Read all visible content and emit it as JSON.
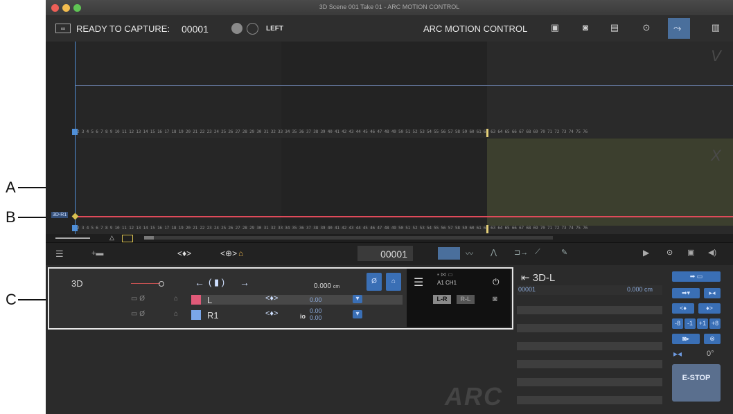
{
  "callouts": {
    "a": "A",
    "b": "B",
    "c": "C"
  },
  "window": {
    "title": "3D Scene 001 Take 01 - ARC MOTION CONTROL"
  },
  "toolbar": {
    "status_label": "READY TO CAPTURE:",
    "take_number": "00001",
    "side_label": "LEFT",
    "app_label": "ARC MOTION CONTROL"
  },
  "timeline": {
    "track_v_label": "V",
    "track_x_label": "X",
    "track_name": "3D-R1",
    "ruler_ticks": "2 3 4 5 6 7 8 9 10 11 12 13 14 15 16 17 18 19 20 21 22 23 24 25 26 27 28 29 30 31 32 33 34 35 36 37 38 39 40 41 42 43 44 45 46 47 48 49 50 51 52 53 54 55 56 57 58 59 60 61 62 63 64 65 66 67 68 69 70 71 72 73 74 75 76"
  },
  "strip": {
    "frame": "00001"
  },
  "panel": {
    "rig_label": "3D",
    "distance": "0.000",
    "distance_unit": "cm",
    "row1_name": "L",
    "row1_value": "0.00",
    "row2_name": "R1",
    "row2_io": "io",
    "row2_value_top": "0.00",
    "row2_value_bottom": "0.00",
    "channel": "A1 CH1",
    "btn_lr": "L-R",
    "btn_rl": "R-L"
  },
  "side": {
    "title": "3D-L",
    "frame": "00001",
    "value": "0.000 cm"
  },
  "right": {
    "stop": "E-STOP",
    "angle": "0°"
  },
  "watermark": "ARC",
  "colors": {
    "track_red": "#e04a5a",
    "accent_blue": "#3a6fb5",
    "range_olive": "#3c3f2e"
  }
}
